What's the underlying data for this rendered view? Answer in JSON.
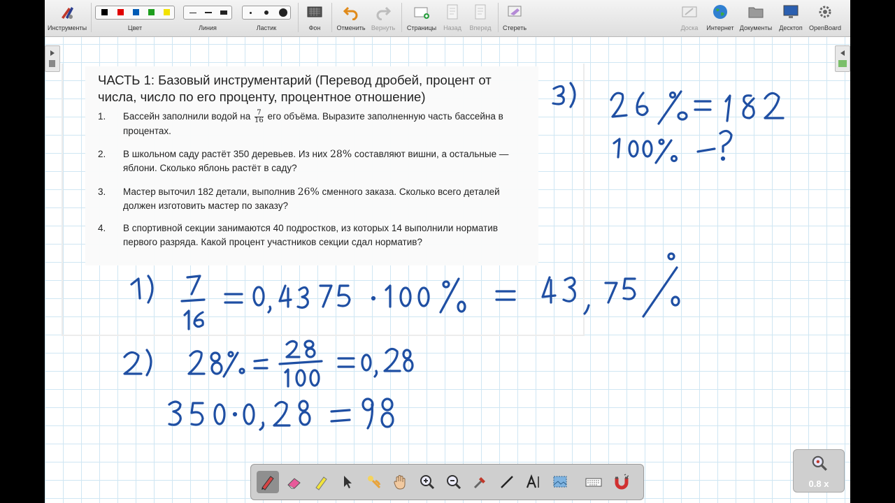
{
  "toolbar": {
    "tools": "Инструменты",
    "color": "Цвет",
    "line": "Линия",
    "eraser": "Ластик",
    "background": "Фон",
    "undo": "Отменить",
    "redo": "Вернуть",
    "pages": "Страницы",
    "back": "Назад",
    "forward": "Вперед",
    "clear": "Стереть",
    "board": "Доска",
    "internet": "Интернет",
    "documents": "Документы",
    "desktop": "Десктоп",
    "openboard": "OpenBoard",
    "colors": [
      "#000000",
      "#e00000",
      "#005bb5",
      "#1e9e1e",
      "#f2e200"
    ]
  },
  "task": {
    "title": "ЧАСТЬ 1: Базовый инструментарий (Перевод дробей, процент от числа, число по его проценту, процентное отношение)",
    "items": [
      {
        "num": "1.",
        "pre": "Бассейн заполнили водой на",
        "frac_num": "7",
        "frac_den": "16",
        "post": "его объёма. Выразите заполненную часть бассейна в процентах."
      },
      {
        "num": "2.",
        "pre": "В школьном саду растёт 350 деревьев. Из них",
        "math": "28%",
        "post": "составляют вишни, а остальные — яблони. Сколько яблонь растёт в саду?"
      },
      {
        "num": "3.",
        "pre": "Мастер выточил 182 детали, выполнив",
        "math": "26%",
        "post": "сменного заказа. Сколько всего деталей должен изготовить мастер по заказу?"
      },
      {
        "num": "4.",
        "text": "В спортивной секции занимаются 40 подростков, из которых 14 выполнили норматив первого разряда. Какой процент участников секции сдал норматив?"
      }
    ]
  },
  "ink_color": "#1f4fa3",
  "zoom": "0.8 x",
  "palette_tools": [
    "pen-icon",
    "eraser-icon",
    "highlighter-icon",
    "pointer-icon",
    "laser-icon",
    "hand-icon",
    "zoom-in-icon",
    "zoom-out-icon",
    "capture-icon",
    "line-icon",
    "text-icon",
    "select-area-icon",
    "keyboard-icon",
    "magnet-icon"
  ]
}
